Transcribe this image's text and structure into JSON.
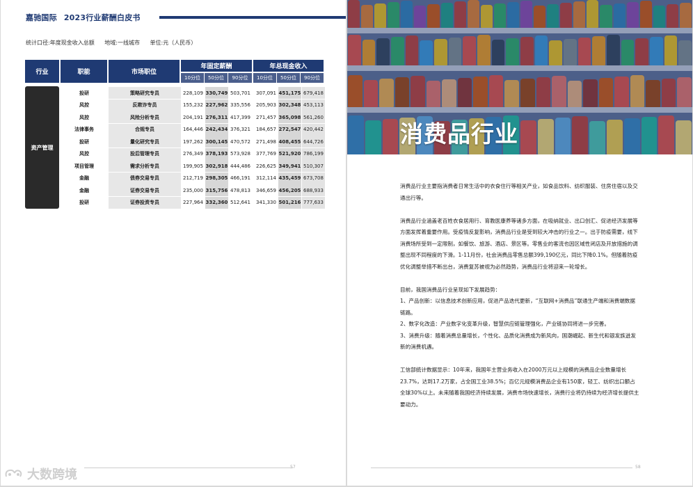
{
  "left_page": {
    "header": {
      "company": "嘉驰国际",
      "title": "2023行业薪酬白皮书"
    },
    "meta": {
      "scope_label": "统计口径:",
      "scope_value": "年度现金收入总额",
      "region_label": "地域:",
      "region_value": "一线城市",
      "unit_label": "单位:",
      "unit_value": "元（人民币）"
    },
    "table": {
      "col_industry": "行业",
      "col_function": "职能",
      "col_position": "市场职位",
      "group_fixed": "年固定薪酬",
      "group_total": "年总现金收入",
      "percentiles": [
        "10分位",
        "50分位",
        "90分位"
      ],
      "section": "资产管理",
      "rows": [
        {
          "func": "投研",
          "pos": "策略研究专员",
          "fixed": [
            "228,109",
            "330,749",
            "503,701"
          ],
          "total": [
            "307,091",
            "451,175",
            "679,418"
          ]
        },
        {
          "func": "风控",
          "pos": "反欺诈专员",
          "fixed": [
            "155,232",
            "227,962",
            "335,556"
          ],
          "total": [
            "205,903",
            "302,348",
            "453,113"
          ]
        },
        {
          "func": "风控",
          "pos": "风险分析专员",
          "fixed": [
            "204,191",
            "276,311",
            "417,399"
          ],
          "total": [
            "271,457",
            "365,098",
            "561,260"
          ]
        },
        {
          "func": "法律事务",
          "pos": "合规专员",
          "fixed": [
            "164,446",
            "242,434",
            "376,321"
          ],
          "total": [
            "184,657",
            "272,547",
            "420,442"
          ]
        },
        {
          "func": "投研",
          "pos": "量化研究专员",
          "fixed": [
            "197,262",
            "300,145",
            "470,572"
          ],
          "total": [
            "271,498",
            "408,455",
            "644,726"
          ]
        },
        {
          "func": "风控",
          "pos": "投后管理专员",
          "fixed": [
            "276,349",
            "378,193",
            "573,928"
          ],
          "total": [
            "377,769",
            "521,920",
            "786,199"
          ]
        },
        {
          "func": "项目管理",
          "pos": "需求分析专员",
          "fixed": [
            "199,905",
            "302,918",
            "444,486"
          ],
          "total": [
            "226,625",
            "349,941",
            "510,307"
          ]
        },
        {
          "func": "金融",
          "pos": "债券交易专员",
          "fixed": [
            "212,719",
            "298,305",
            "466,191"
          ],
          "total": [
            "312,114",
            "435,459",
            "673,708"
          ]
        },
        {
          "func": "金融",
          "pos": "证券交易专员",
          "fixed": [
            "235,000",
            "315,756",
            "478,813"
          ],
          "total": [
            "346,659",
            "456,205",
            "688,933"
          ]
        },
        {
          "func": "投研",
          "pos": "证券投资专员",
          "fixed": [
            "227,964",
            "332,360",
            "512,641"
          ],
          "total": [
            "341,330",
            "501,216",
            "777,633"
          ]
        }
      ]
    },
    "page_number": "57",
    "watermark": "大数跨境"
  },
  "right_page": {
    "title": "消费品行业",
    "paragraphs": [
      "消费品行业主要指消费者日常生活中的衣食住行等相关产业，如食品饮料、纺织服装、住房住宿以及交通出行等。",
      "消费品行业涵盖老百姓衣食居用行、育教医康养等诸多方面，在吸纳就业、出口创汇、促进经济发展等方面发挥着重要作用。受疫情反复影响，消费品行业是受到较大冲击的行业之一。出于防疫需要，线下消费场所受到一定限制，如餐饮、旅游、酒店、景区等。零售业的客流也因区域性闭店及开放措施的调整出现不同程度的下滑。1-11月份，社会消费品零售总额399,190亿元，同比下降0.1%。但随着防疫优化调整举措不断出台，消费复苏被视为必然趋势，消费品行业将迎来一轮增长。"
    ],
    "trend_intro": "目前，我国消费品行业呈现如下发展趋势：",
    "trends": [
      "1、产品创新：以信息技术创新应用，促进产品迭代更新，“互联网+消费品”联通生产端和消费端数据链路。",
      "2、数字化改造：产业数字化变革升级，智慧供应链管理强化，产业链协同将进一步完善。",
      "3、消费升级：随着消费总量增长，个性化、品质化消费成为新风向，国潮崛起、新生代和银发族迸发新的消费机遇。"
    ],
    "closing": "工信部统计数据显示：10年来，我国年主营业务收入在2000万元以上规模的消费品企业数量增长23.7%，达到17.2万家，占全国工业38.5%；百亿元规模消费品企业有150家，轻工、纺织出口额占全球30%以上。未来随着我国经济持续发展，消费市场快速增长，消费行业将仍持续为经济增长提供主要动力。",
    "page_number": "58"
  },
  "colors": {
    "navy": "#1f3a73",
    "dark_section": "#2a2a2a"
  }
}
